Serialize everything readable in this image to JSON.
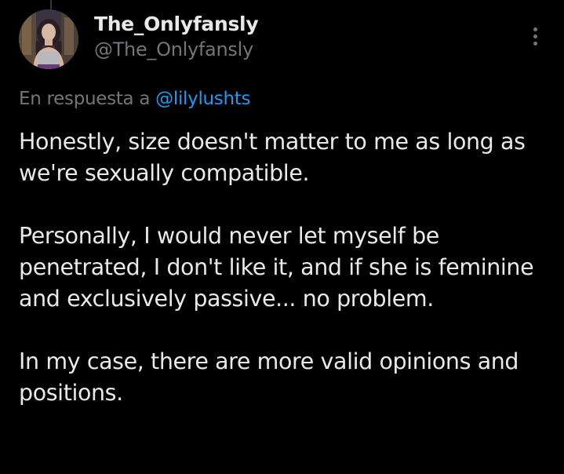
{
  "author": {
    "display_name": "The_Onlyfansly",
    "handle": "@The_Onlyfansly",
    "avatar": "profile-photo"
  },
  "reply_context": {
    "prefix": "En respuesta a",
    "mention": "@lilylushts"
  },
  "tweet": {
    "paragraphs": [
      "Honestly, size doesn't matter to me as long as we're sexually compatible.",
      "Personally, I would never let myself be penetrated, I don't like it, and if she is feminine and exclusively passive... no problem.",
      "In my case, there are more valid opinions and positions."
    ]
  },
  "icons": {
    "more": "more-options-icon"
  },
  "colors": {
    "background": "#000000",
    "primary_text": "#e7e9ea",
    "secondary_text": "#71767b",
    "link": "#1d9bf0",
    "thread_line": "#333639"
  }
}
